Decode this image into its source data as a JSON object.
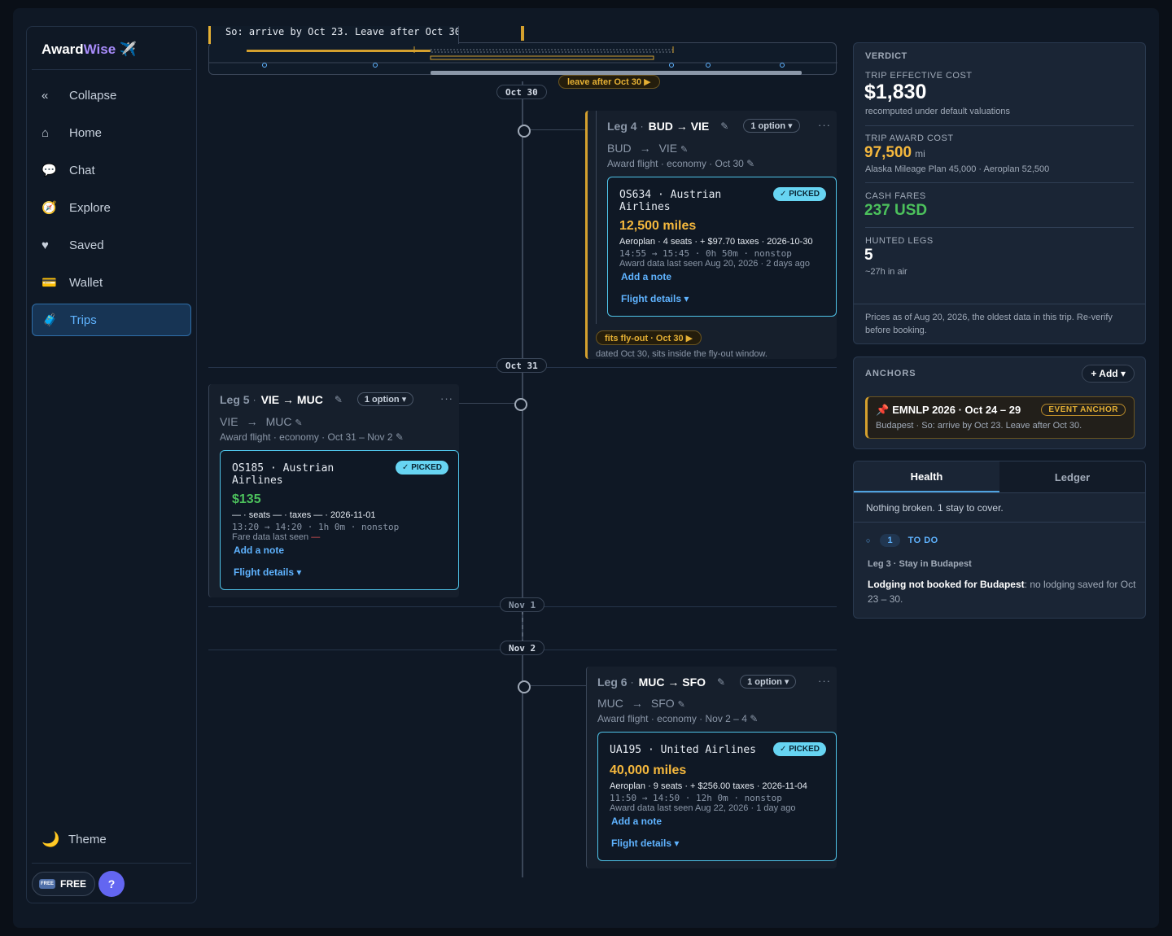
{
  "app": {
    "brand_main": "Award",
    "brand_accent": "Wise",
    "brand_icon": "✈️"
  },
  "sidebar": {
    "items": [
      {
        "icon": "«",
        "label": "Collapse",
        "name": "collapse"
      },
      {
        "icon": "⌂",
        "label": "Home",
        "name": "home"
      },
      {
        "icon": "💬",
        "label": "Chat",
        "name": "chat"
      },
      {
        "icon": "🧭",
        "label": "Explore",
        "name": "explore"
      },
      {
        "icon": "♥",
        "label": "Saved",
        "name": "saved"
      },
      {
        "icon": "💳",
        "label": "Wallet",
        "name": "wallet"
      },
      {
        "icon": "🧳",
        "label": "Trips",
        "name": "trips",
        "active": true
      }
    ],
    "theme_icon": "🌙",
    "theme_label": "Theme",
    "plan_icon": "FREE",
    "plan_label": "FREE",
    "help_label": "?"
  },
  "timeline": {
    "anchor_note": "So: arrive by Oct 23. Leave after Oct 30.",
    "leave_pill": "leave after Oct 30 ▶",
    "days": [
      "Oct 30",
      "Oct 31",
      "Nov 1",
      "Nov 2"
    ],
    "legs": [
      {
        "leg_no": "Leg 4",
        "route": "BUD → VIE",
        "options": "1 option ▾",
        "from": "BUD",
        "to": "VIE",
        "meta": "Award flight · economy · Oct 30 ✎",
        "flight": "OS634 · Austrian Airlines",
        "picked": "✓ PICKED",
        "price": "12,500 miles",
        "detail": "Aeroplan · 4 seats · + $97.70 taxes · 2026-10-30",
        "times": "14:55 → 15:45 · 0h 50m · nonstop",
        "seen": "Award data last seen Aug 20, 2026 · 2 days ago",
        "add_note": "Add a note",
        "flight_details": "Flight details ▾",
        "fits_pill": "fits fly-out · Oct 30 ▶",
        "fits_text": "dated Oct 30, sits inside the fly-out window."
      },
      {
        "leg_no": "Leg 5",
        "route": "VIE → MUC",
        "options": "1 option ▾",
        "from": "VIE",
        "to": "MUC",
        "meta": "Award flight · economy · Oct 31 – Nov 2 ✎",
        "flight": "OS185 · Austrian Airlines",
        "picked": "✓ PICKED",
        "price": "$135",
        "detail": "— · seats — · taxes — · 2026-11-01",
        "times": "13:20 → 14:20 · 1h 0m · nonstop",
        "seen": "Fare data last seen",
        "seen_missing": "—",
        "add_note": "Add a note",
        "flight_details": "Flight details ▾"
      },
      {
        "leg_no": "Leg 6",
        "route": "MUC → SFO",
        "options": "1 option ▾",
        "from": "MUC",
        "to": "SFO",
        "meta": "Award flight · economy · Nov 2 – 4 ✎",
        "flight": "UA195 · United Airlines",
        "picked": "✓ PICKED",
        "price": "40,000 miles",
        "detail": "Aeroplan · 9 seats · + $256.00 taxes · 2026-11-04",
        "times": "11:50 → 14:50 · 12h 0m · nonstop",
        "seen": "Award data last seen Aug 22, 2026 · 1 day ago",
        "add_note": "Add a note",
        "flight_details": "Flight details ▾"
      }
    ]
  },
  "verdict": {
    "title": "VERDICT",
    "effective_label": "TRIP EFFECTIVE COST",
    "effective_value": "$1,830",
    "effective_sub": "recomputed under default valuations",
    "award_label": "TRIP AWARD COST",
    "award_value": "97,500",
    "award_unit": "mi",
    "award_sub": "Alaska Mileage Plan 45,000 · Aeroplan 52,500",
    "cash_label": "CASH FARES",
    "cash_value": "237 USD",
    "legs_label": "HUNTED LEGS",
    "legs_value": "5",
    "legs_sub": "~27h in air",
    "footer": "Prices as of Aug 20, 2026, the oldest data in this trip. Re-verify before booking."
  },
  "anchors": {
    "title": "ANCHORS",
    "add_label": "+ Add ▾",
    "card_title": "EMNLP 2026 · Oct 24 – 29",
    "card_badge": "EVENT ANCHOR",
    "card_sub": "Budapest · So: arrive by Oct 23. Leave after Oct 30."
  },
  "health": {
    "tabs": [
      "Health",
      "Ledger"
    ],
    "summary": "Nothing broken. 1 stay to cover.",
    "todo_count": "1",
    "todo_label": "TO DO",
    "leg_label": "Leg 3 · Stay in Budapest",
    "issue_bold": "Lodging not booked for Budapest",
    "issue_rest": ": no lodging saved for Oct 23 – 30."
  },
  "colors": {
    "accent": "#a78bfa",
    "gold": "#f5b83d",
    "green": "#4cc15c",
    "link": "#5fb3ff",
    "picked": "#67d4f2"
  }
}
